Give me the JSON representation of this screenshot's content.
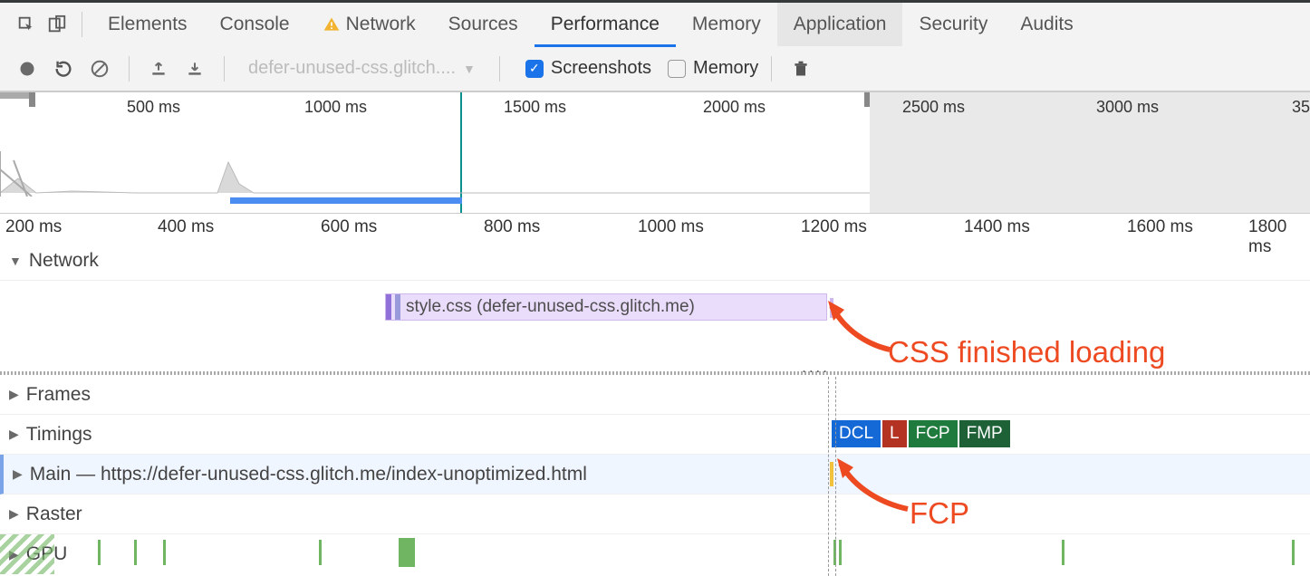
{
  "tabs": {
    "elements": "Elements",
    "console": "Console",
    "network": "Network",
    "sources": "Sources",
    "performance": "Performance",
    "memory": "Memory",
    "application": "Application",
    "security": "Security",
    "audits": "Audits"
  },
  "toolbar": {
    "recording_name": "defer-unused-css.glitch....",
    "checkbox_screenshots": "Screenshots",
    "checkbox_memory": "Memory"
  },
  "overview_ticks": [
    "500 ms",
    "1000 ms",
    "1500 ms",
    "2000 ms",
    "2500 ms",
    "3000 ms",
    "35"
  ],
  "ruler_ticks": [
    "200 ms",
    "400 ms",
    "600 ms",
    "800 ms",
    "1000 ms",
    "1200 ms",
    "1400 ms",
    "1600 ms",
    "1800 ms"
  ],
  "network": {
    "title": "Network",
    "request_label": "style.css (defer-unused-css.glitch.me)"
  },
  "panes": {
    "frames": "Frames",
    "timings": "Timings",
    "main": "Main — https://defer-unused-css.glitch.me/index-unoptimized.html",
    "raster": "Raster",
    "gpu": "GPU"
  },
  "timing_chips": {
    "dcl": "DCL",
    "l": "L",
    "fcp": "FCP",
    "fmp": "FMP"
  },
  "annotations": {
    "css_loaded": "CSS finished loading",
    "fcp": "FCP"
  }
}
